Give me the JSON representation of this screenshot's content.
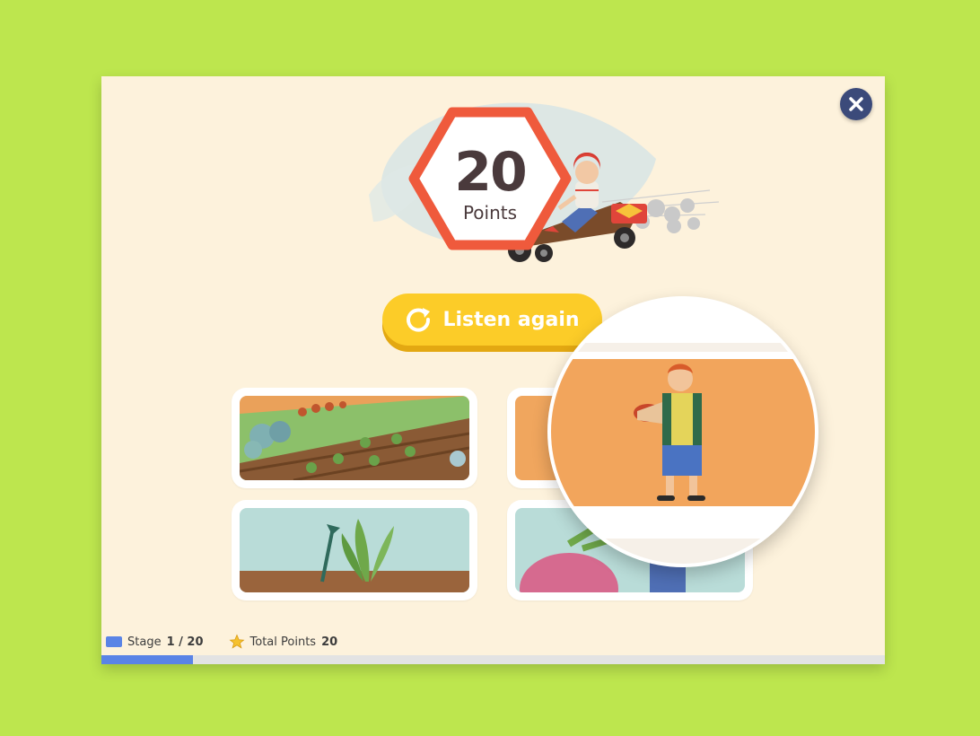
{
  "score": {
    "value": "20",
    "label": "Points"
  },
  "actions": {
    "listen_again": "Listen again"
  },
  "close": {
    "icon": "close-icon"
  },
  "status": {
    "stage_label": "Stage",
    "stage_value": "1 / 20",
    "total_label": "Total Points",
    "total_value": "20"
  },
  "progress": {
    "fraction": 0.05
  },
  "colors": {
    "background": "#bde64e",
    "panel": "#fdf2dc",
    "accent_button": "#fccc28",
    "hexagon_border": "#ef5a3c",
    "close_button": "#3b4a7a",
    "progress": "#5a84e6"
  }
}
